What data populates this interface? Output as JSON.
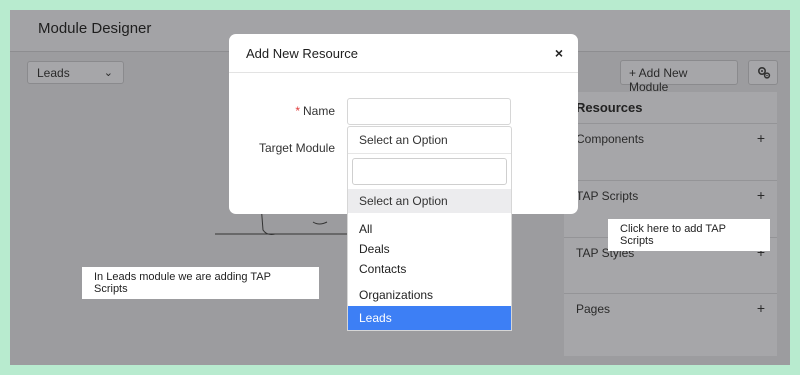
{
  "page": {
    "title": "Module Designer",
    "module_select": "Leads",
    "add_module_label": "+ Add New Module"
  },
  "resources": {
    "title": "Resources",
    "items": [
      {
        "label": "Components"
      },
      {
        "label": "TAP Scripts"
      },
      {
        "label": "TAP Styles"
      },
      {
        "label": "Pages"
      }
    ]
  },
  "modal": {
    "title": "Add New Resource",
    "close": "×",
    "name_label": "Name",
    "required_mark": "*",
    "name_value": "",
    "target_label": "Target Module",
    "target_selected": "Select an Option",
    "search_value": "",
    "options": [
      {
        "label": "Select an Option"
      },
      {
        "label": "All"
      },
      {
        "label": "Deals"
      },
      {
        "label": "Contacts"
      },
      {
        "label": "Organizations"
      },
      {
        "label": "Leads"
      }
    ],
    "highlighted_option": "Leads"
  },
  "callouts": {
    "left": "In Leads module we are adding TAP Scripts",
    "right": "Click here to add TAP Scripts"
  },
  "colors": {
    "overlay": "#9c9c9f",
    "highlight": "#3d7ff5",
    "required": "#e03c3c",
    "border": "#b8ebcf"
  },
  "icons": {
    "chevron": "chevron-down-icon",
    "settings": "settings-gears-icon",
    "plus": "plus-icon",
    "close": "close-icon"
  }
}
